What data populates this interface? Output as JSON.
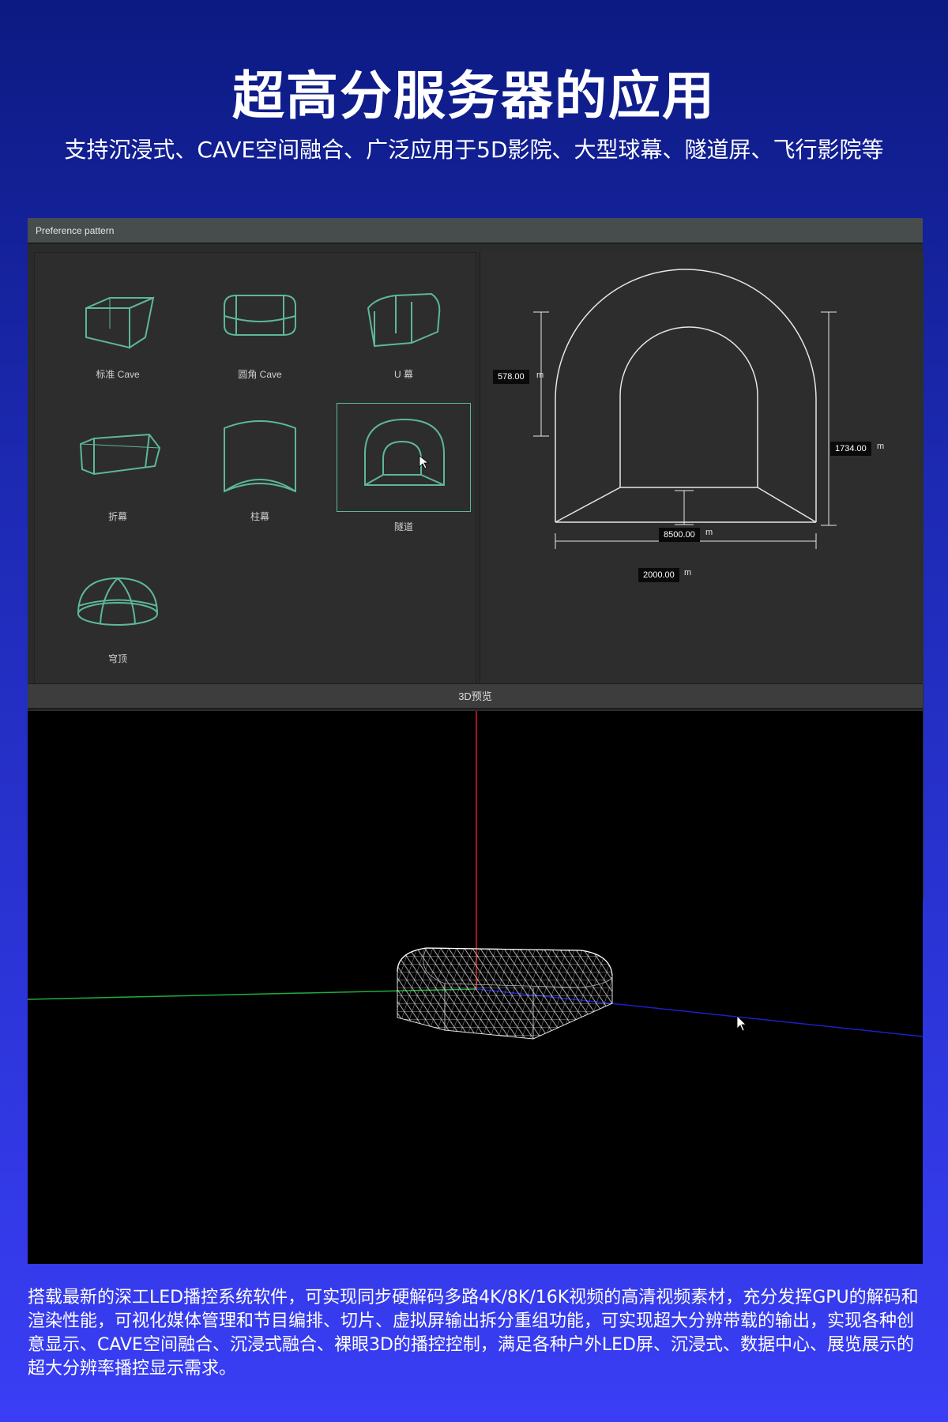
{
  "hero": {
    "title": "超高分服务器的应用",
    "subtitle": "支持沉浸式、CAVE空间融合、广泛应用于5D影院、大型球幕、隧道屏、飞行影院等"
  },
  "window": {
    "title": "Preference pattern"
  },
  "patterns": [
    {
      "label": "标准 Cave",
      "icon": "standard-cave-icon",
      "selected": false
    },
    {
      "label": "圆角 Cave",
      "icon": "rounded-cave-icon",
      "selected": false
    },
    {
      "label": "U 幕",
      "icon": "u-screen-icon",
      "selected": false
    },
    {
      "label": "折幕",
      "icon": "folding-screen-icon",
      "selected": false
    },
    {
      "label": "柱幕",
      "icon": "cylinder-screen-icon",
      "selected": false
    },
    {
      "label": "隧道",
      "icon": "tunnel-icon",
      "selected": true
    },
    {
      "label": "穹顶",
      "icon": "dome-icon",
      "selected": false
    }
  ],
  "diagram": {
    "arch_radius": "578.00",
    "height": "1734.00",
    "depth": "8500.00",
    "width": "2000.00",
    "unit": "m"
  },
  "preview": {
    "header": "3D预览"
  },
  "description": "搭载最新的深工LED播控系统软件，可实现同步硬解码多路4K/8K/16K视频的高清视频素材，充分发挥GPU的解码和渲染性能，可视化媒体管理和节目编排、切片、虚拟屏输出拆分重组功能，可实现超大分辨带载的输出，实现各种创意显示、CAVE空间融合、沉浸式融合、裸眼3D的播控控制，满足各种户外LED屏、沉浸式、数据中心、展览展示的超大分辨率播控显示需求。",
  "colors": {
    "accent": "#5db896",
    "background_top": "#0c1a82",
    "background_bottom": "#3a3ef5"
  }
}
